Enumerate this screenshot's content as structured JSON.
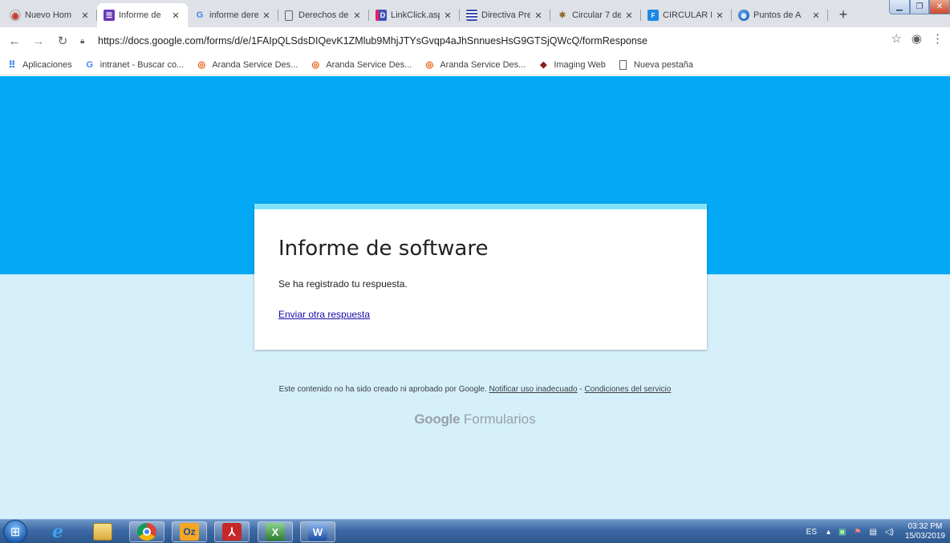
{
  "tabs": [
    {
      "title": "Nuevo Hom",
      "favicon": "aranda-icon",
      "active": false
    },
    {
      "title": "Informe de",
      "favicon": "google-forms-icon",
      "active": true
    },
    {
      "title": "informe dere",
      "favicon": "google-icon",
      "active": false
    },
    {
      "title": "Derechos de",
      "favicon": "document-icon",
      "active": false
    },
    {
      "title": "LinkClick.asp",
      "favicon": "linkclick-icon",
      "active": false
    },
    {
      "title": "Directiva Pre",
      "favicon": "directiva-icon",
      "active": false
    },
    {
      "title": "Circular 7 de",
      "favicon": "circular-icon",
      "active": false
    },
    {
      "title": "CIRCULAR N",
      "favicon": "circular-doc-icon",
      "active": false
    },
    {
      "title": "Puntos de A",
      "favicon": "globe-icon",
      "active": false
    }
  ],
  "toolbar": {
    "url": "https://docs.google.com/forms/d/e/1FAIpQLSdsDIQevK1ZMlub9MhjJTYsGvqp4aJhSnnuesHsG9GTSjQWcQ/formResponse"
  },
  "bookmarks": [
    {
      "label": "Aplicaciones",
      "icon": "apps-grid-icon"
    },
    {
      "label": "intranet - Buscar co...",
      "icon": "google-icon"
    },
    {
      "label": "Aranda Service Des...",
      "icon": "aranda-icon"
    },
    {
      "label": "Aranda Service Des...",
      "icon": "aranda-icon"
    },
    {
      "label": "Aranda Service Des...",
      "icon": "aranda-icon"
    },
    {
      "label": "Imaging Web",
      "icon": "imaging-icon"
    },
    {
      "label": "Nueva pestaña",
      "icon": "document-icon"
    }
  ],
  "form": {
    "title": "Informe de software",
    "message": "Se ha registrado tu respuesta.",
    "again_link": "Enviar otra respuesta",
    "header_color": "#03a9f4",
    "accent_color": "#81e3fa",
    "background_color": "#d5f0fb"
  },
  "footer": {
    "disclaimer": "Este contenido no ha sido creado ni aprobado por Google.",
    "report_link": "Notificar uso inadecuado",
    "separator": "-",
    "terms_link": "Condiciones del servicio",
    "brand_google": "Google",
    "brand_product": "Formularios"
  },
  "taskbar": {
    "apps": [
      "internet-explorer-icon",
      "file-explorer-icon",
      "chrome-icon",
      "outlook-icon",
      "acrobat-icon",
      "excel-icon",
      "word-icon"
    ],
    "language": "ES",
    "time": "03:32 PM",
    "date": "15/03/2019"
  }
}
